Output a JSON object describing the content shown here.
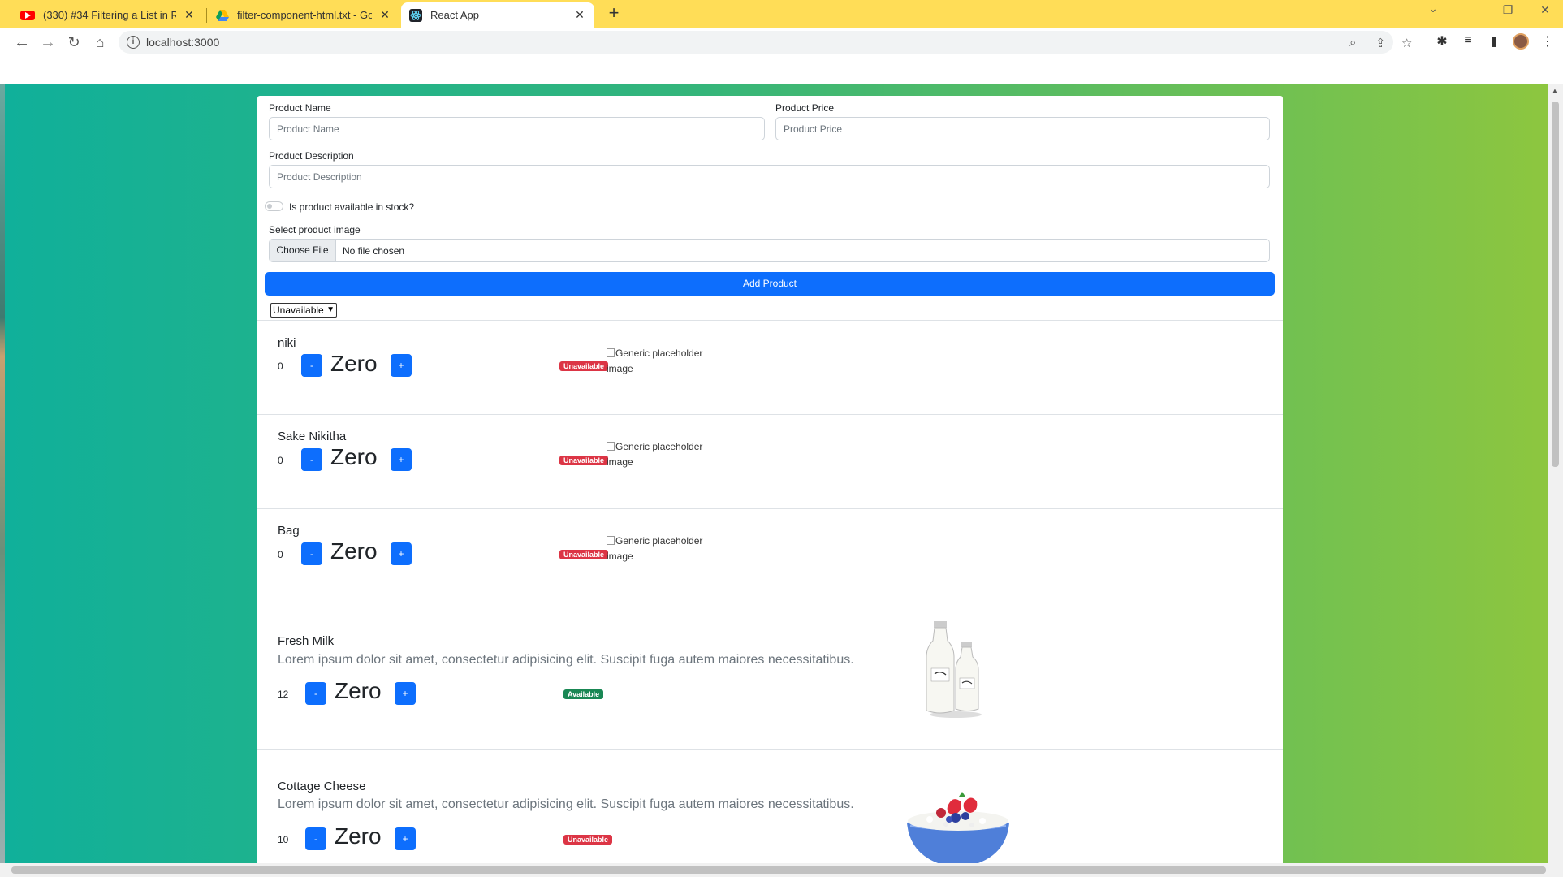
{
  "browser": {
    "tabs": [
      {
        "label": "(330) #34 Filtering a List in React |",
        "icon": "youtube-icon"
      },
      {
        "label": "filter-component-html.txt - Goo",
        "icon": "google-drive-icon"
      },
      {
        "label": "React App",
        "icon": "react-icon"
      }
    ],
    "url": "localhost:3000"
  },
  "form": {
    "name_label": "Product Name",
    "name_placeholder": "Product Name",
    "price_label": "Product Price",
    "price_placeholder": "Product Price",
    "desc_label": "Product Description",
    "desc_placeholder": "Product Description",
    "stock_label": "Is product available in stock?",
    "image_label": "Select product image",
    "choose_file": "Choose File",
    "no_file": "No file chosen",
    "add_button": "Add Product"
  },
  "filter": {
    "selected": "Unavailable"
  },
  "products": [
    {
      "name": "niki",
      "description": "",
      "quantity": "0",
      "count_text": "Zero",
      "minus": "-",
      "plus": "+",
      "status": "Unavailable",
      "image_alt": "Generic placeholder image"
    },
    {
      "name": "Sake Nikitha",
      "description": "",
      "quantity": "0",
      "count_text": "Zero",
      "minus": "-",
      "plus": "+",
      "status": "Unavailable",
      "image_alt": "Generic placeholder image"
    },
    {
      "name": "Bag",
      "description": "",
      "quantity": "0",
      "count_text": "Zero",
      "minus": "-",
      "plus": "+",
      "status": "Unavailable",
      "image_alt": "Generic placeholder image"
    },
    {
      "name": "Fresh Milk",
      "description": "Lorem ipsum dolor sit amet, consectetur adipisicing elit. Suscipit fuga autem maiores necessitatibus.",
      "quantity": "12",
      "count_text": "Zero",
      "minus": "-",
      "plus": "+",
      "status": "Available",
      "image": "milk-bottles"
    },
    {
      "name": "Cottage Cheese",
      "description": "Lorem ipsum dolor sit amet, consectetur adipisicing elit. Suscipit fuga autem maiores necessitatibus.",
      "quantity": "10",
      "count_text": "Zero",
      "minus": "-",
      "plus": "+",
      "status": "Unavailable",
      "image": "cheese-bowl-with-berries"
    }
  ],
  "colors": {
    "primary": "#0d6efd",
    "danger": "#dc3545",
    "success": "#198754",
    "gradient_start": "#10b09a",
    "gradient_end": "#8dc63f",
    "tabbar": "#ffdd57"
  }
}
